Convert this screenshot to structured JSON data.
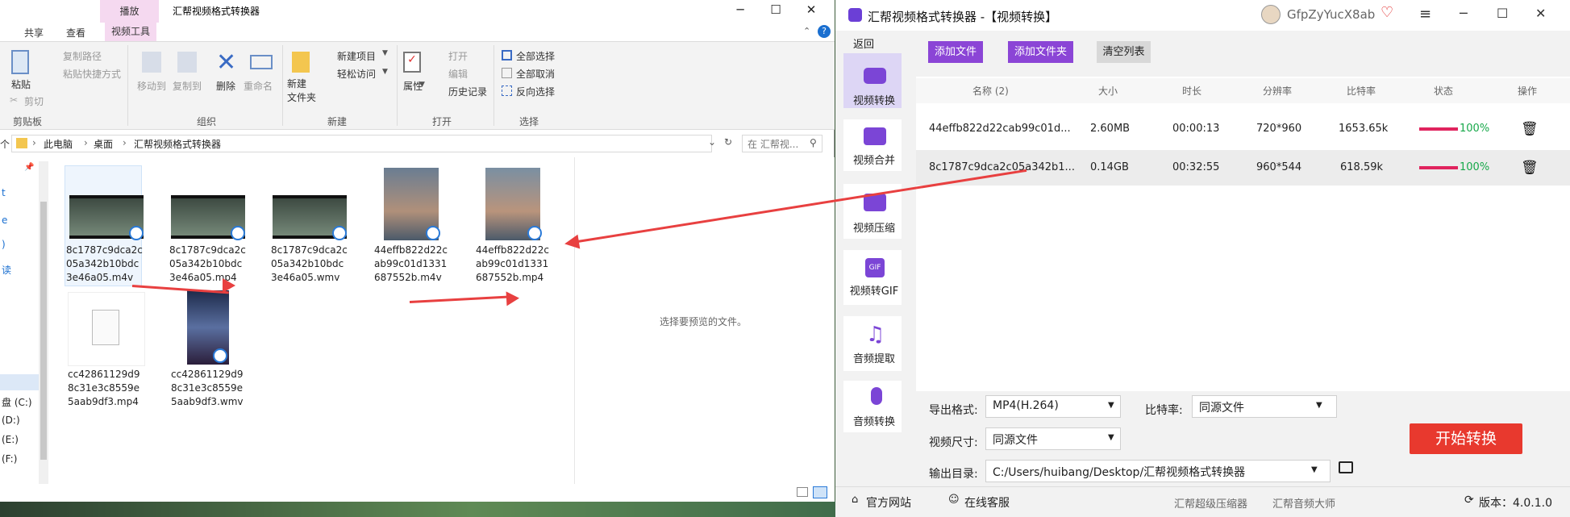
{
  "explorer": {
    "title": "汇帮视频格式转换器",
    "context_tab": "播放",
    "tabs": [
      "共享",
      "查看",
      "视频工具"
    ],
    "ribbon": {
      "clipboard": {
        "paste": "粘贴",
        "copy_path": "复制路径",
        "paste_shortcut": "粘贴快捷方式",
        "cut": "剪切",
        "group": "剪贴板"
      },
      "organize": {
        "move_to": "移动到",
        "copy_to": "复制到",
        "delete": "删除",
        "rename": "重命名",
        "group": "组织"
      },
      "new": {
        "new_folder": "新建\n文件夹",
        "new_item": "新建项目",
        "easy_access": "轻松访问",
        "group": "新建"
      },
      "open": {
        "properties": "属性",
        "open": "打开",
        "edit": "编辑",
        "history": "历史记录",
        "group": "打开"
      },
      "select": {
        "select_all": "全部选择",
        "select_none": "全部取消",
        "invert": "反向选择",
        "group": "选择"
      }
    },
    "breadcrumb": [
      "此电脑",
      "桌面",
      "汇帮视频格式转换器"
    ],
    "search_placeholder": "在 汇帮视...",
    "nav_drives": [
      "盘 (C:)",
      "(D:)",
      "(E:)",
      "(F:)"
    ],
    "files": [
      {
        "name": "8c1787c9dca2c05a342b10bdc3e46a05.m4v",
        "kind": "classroom"
      },
      {
        "name": "8c1787c9dca2c05a342b10bdc3e46a05.mp4",
        "kind": "classroom"
      },
      {
        "name": "8c1787c9dca2c05a342b10bdc3e46a05.wmv",
        "kind": "classroom"
      },
      {
        "name": "44effb822d22cab99c01d1331687552b.m4v",
        "kind": "dance"
      },
      {
        "name": "44effb822d22cab99c01d1331687552b.mp4",
        "kind": "dance"
      },
      {
        "name": "cc42861129d98c31e3c8559e5aab9df3.mp4",
        "kind": "blank"
      },
      {
        "name": "cc42861129d98c31e3c8559e5aab9df3.wmv",
        "kind": "poster"
      }
    ],
    "preview_text": "选择要预览的文件。"
  },
  "app": {
    "title": "汇帮视频格式转换器 -【视频转换】",
    "user": "GfpZyYucX8ab",
    "back": "返回",
    "sidebar": [
      "视频转换",
      "视频合并",
      "视频压缩",
      "视频转GIF",
      "音频提取",
      "音频转换"
    ],
    "toolbar": {
      "add_file": "添加文件",
      "add_folder": "添加文件夹",
      "clear": "清空列表"
    },
    "columns": [
      "名称 (2)",
      "大小",
      "时长",
      "分辨率",
      "比特率",
      "状态",
      "操作"
    ],
    "rows": [
      {
        "name": "44effb822d22cab99c01d...",
        "size": "2.60MB",
        "duration": "00:00:13",
        "resolution": "720*960",
        "bitrate": "1653.65k",
        "status": "100%",
        "progress": 1.0
      },
      {
        "name": "8c1787c9dca2c05a342b1...",
        "size": "0.14GB",
        "duration": "00:32:55",
        "resolution": "960*544",
        "bitrate": "618.59k",
        "status": "100%",
        "progress": 1.0
      }
    ],
    "settings": {
      "format_label": "导出格式:",
      "format_value": "MP4(H.264)",
      "bitrate_label": "比特率:",
      "bitrate_value": "同源文件",
      "size_label": "视频尺寸:",
      "size_value": "同源文件",
      "output_label": "输出目录:",
      "output_value": "C:/Users/huibang/Desktop/汇帮视频格式转换器"
    },
    "start_button": "开始转换",
    "footer": {
      "website": "官方网站",
      "support": "在线客服",
      "compressor": "汇帮超级压缩器",
      "audio_master": "汇帮音频大师",
      "version": "版本：4.0.1.0"
    },
    "colors": {
      "accent": "#8b45d6",
      "start": "#e8392e",
      "progress": "#e0245e"
    }
  }
}
